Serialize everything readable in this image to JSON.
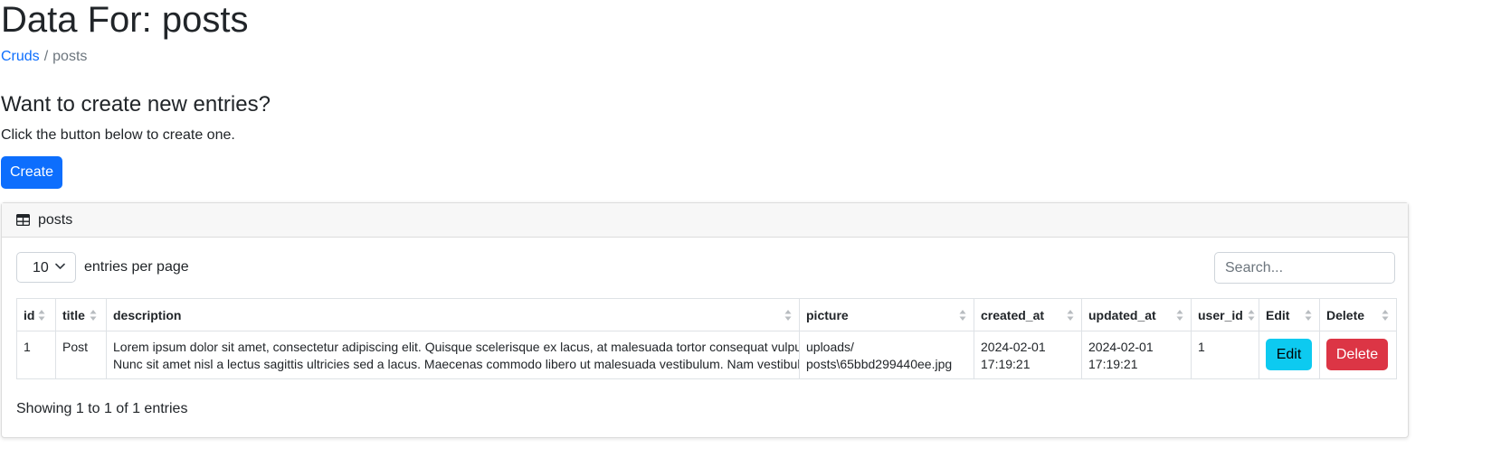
{
  "page": {
    "title": "Data For: posts"
  },
  "breadcrumb": {
    "link": "Cruds",
    "separator": "/",
    "current": "posts"
  },
  "create_section": {
    "heading": "Want to create new entries?",
    "text": "Click the button below to create one.",
    "button_label": "Create",
    "button_color": "#0d6efd"
  },
  "card": {
    "icon": "table-icon",
    "title": "posts"
  },
  "controls": {
    "per_page_value": "10",
    "per_page_label": "entries per page",
    "search_placeholder": "Search..."
  },
  "table": {
    "columns": [
      "id",
      "title",
      "description",
      "picture",
      "created_at",
      "updated_at",
      "user_id",
      "Edit",
      "Delete"
    ],
    "rows": [
      {
        "id": "1",
        "title": "Post",
        "description_line1": "Lorem ipsum dolor sit amet, consectetur adipiscing elit. Quisque scelerisque ex lacus, at malesuada tortor consequat vulputate.",
        "description_line2": "Nunc sit amet nisl a lectus sagittis ultricies sed a lacus. Maecenas commodo libero ut malesuada vestibulum. Nam vestibulum mol",
        "picture_line1": "uploads/",
        "picture_line2": "posts\\65bbd299440ee.jpg",
        "created_at_line1": "2024-02-01",
        "created_at_line2": "17:19:21",
        "updated_at_line1": "2024-02-01",
        "updated_at_line2": "17:19:21",
        "user_id": "1",
        "edit_label": "Edit",
        "delete_label": "Delete"
      }
    ],
    "edit_color": "#0dcaf0",
    "delete_color": "#dc3545"
  },
  "footer": {
    "info": "Showing 1 to 1 of 1 entries"
  }
}
